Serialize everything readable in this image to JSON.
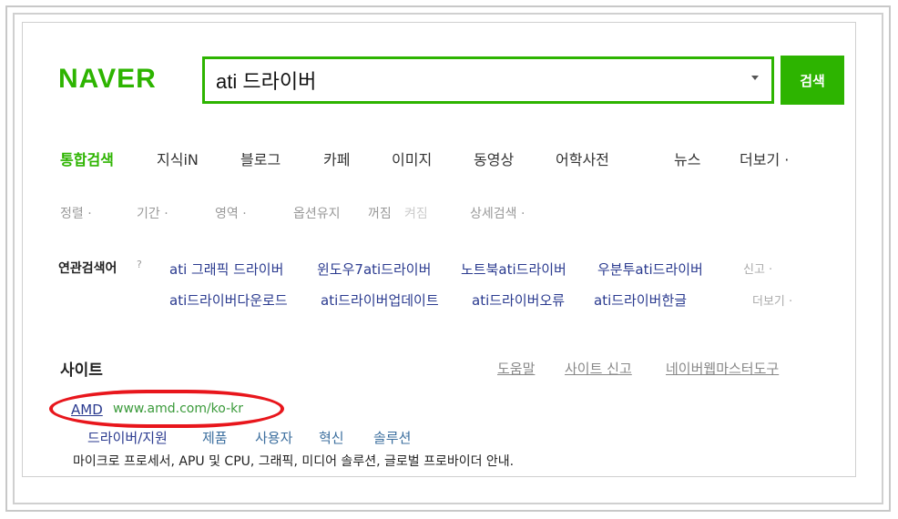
{
  "header": {
    "logo": "NAVER",
    "search_value": "ati 드라이버",
    "search_button": "검색"
  },
  "tabs": [
    {
      "label": "통합검색",
      "active": true
    },
    {
      "label": "지식iN"
    },
    {
      "label": "블로그"
    },
    {
      "label": "카페"
    },
    {
      "label": "이미지"
    },
    {
      "label": "동영상"
    },
    {
      "label": "어학사전"
    },
    {
      "label": "뉴스"
    },
    {
      "label": "더보기 ·"
    }
  ],
  "filters": [
    {
      "label": "정렬 ·"
    },
    {
      "label": "기간 ·"
    },
    {
      "label": "영역 ·"
    },
    {
      "label": "옵션유지"
    },
    {
      "label": "꺼짐"
    },
    {
      "label": "켜짐"
    },
    {
      "label": "상세검색 ·"
    }
  ],
  "related": {
    "title": "연관검색어",
    "arrow": "?",
    "row1": [
      "ati 그래픽 드라이버",
      "윈도우7ati드라이버",
      "노트북ati드라이버",
      "우분투ati드라이버"
    ],
    "row2": [
      "ati드라이버다운로드",
      "ati드라이버업데이트",
      "ati드라이버오류",
      "ati드라이버한글"
    ],
    "report": "신고 ·",
    "more": "더보기 ·"
  },
  "site_section": {
    "title": "사이트",
    "links": [
      "도움말",
      "사이트 신고",
      "네이버웹마스터도구"
    ]
  },
  "result": {
    "title": "AMD",
    "url": "www.amd.com/ko-kr",
    "sublinks": [
      "드라이버/지원",
      "제품",
      "사용자",
      "혁신",
      "솔루션"
    ],
    "description": "마이크로 프로세서, APU 및 CPU, 그래픽, 미디어 솔루션, 글로벌 프로바이더 안내."
  },
  "colors": {
    "brand_green": "#2db400",
    "highlight_red": "#e8161c",
    "link_blue": "#2a3a8f"
  }
}
